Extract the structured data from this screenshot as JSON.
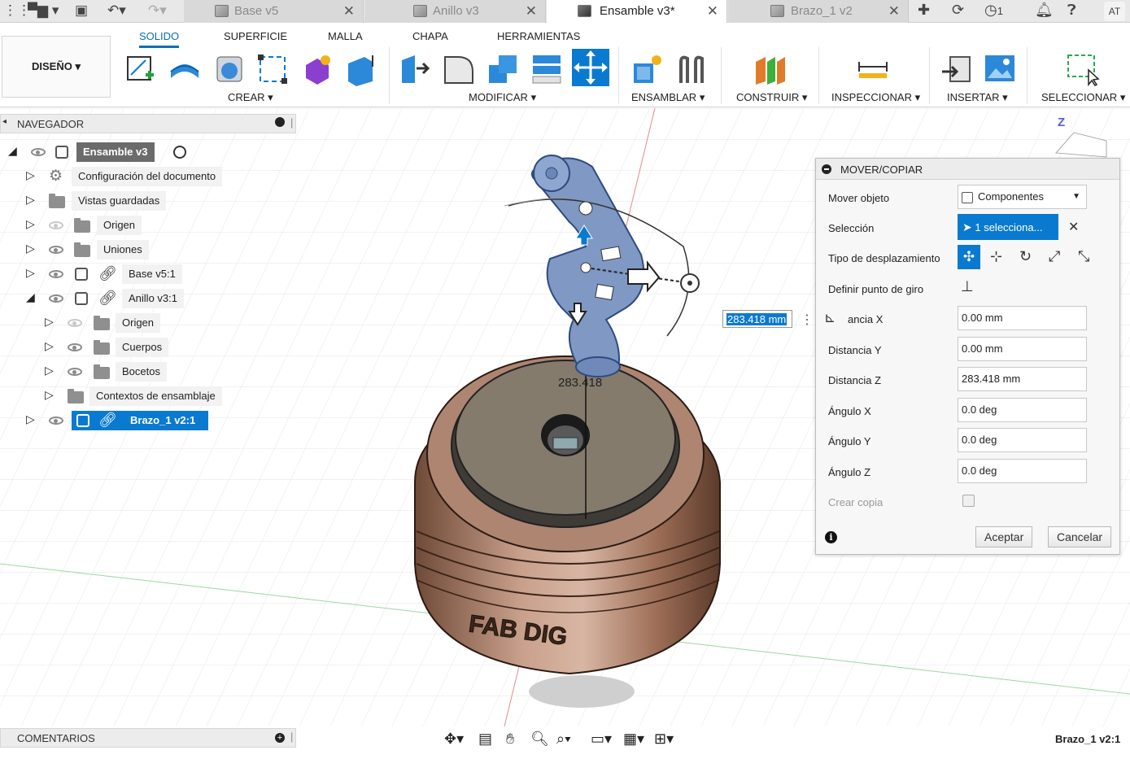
{
  "tabs": [
    {
      "label": "Base v5",
      "active": false
    },
    {
      "label": "Anillo v3",
      "active": false
    },
    {
      "label": "Ensamble v3*",
      "active": true
    },
    {
      "label": "Brazo_1 v2",
      "active": false
    }
  ],
  "titlebar": {
    "clock_count": "1",
    "user_initials": "AT"
  },
  "ribbon": {
    "workspace": "DISEÑO",
    "tabs": [
      "SOLIDO",
      "SUPERFICIE",
      "MALLA",
      "CHAPA",
      "HERRAMIENTAS"
    ],
    "groups": [
      "CREAR",
      "MODIFICAR",
      "ENSAMBLAR",
      "CONSTRUIR",
      "INSPECCIONAR",
      "INSERTAR",
      "SELECCIONAR"
    ]
  },
  "navigator": {
    "title": "NAVEGADOR",
    "root": "Ensamble v3",
    "items": [
      "Configuración del documento",
      "Vistas guardadas",
      "Origen",
      "Uniones",
      "Base v5:1",
      "Anillo v3:1",
      "Origen",
      "Cuerpos",
      "Bocetos",
      "Contextos de ensamblaje",
      "Brazo_1 v2:1"
    ]
  },
  "viewport": {
    "distance_input": "283.418 mm",
    "distance_label": "283.418",
    "engraving": "FAB DIG",
    "viewcube_axis": "Z"
  },
  "dialog": {
    "title": "MOVER/COPIAR",
    "move_object_label": "Mover objeto",
    "move_object_value": "Componentes",
    "selection_label": "Selección",
    "selection_value": "1 selecciona...",
    "move_type_label": "Tipo de desplazamiento",
    "pivot_label": "Definir punto de giro",
    "dist_x_label": "ancia X",
    "dist_x": "0.00 mm",
    "dist_y_label": "Distancia Y",
    "dist_y": "0.00 mm",
    "dist_z_label": "Distancia Z",
    "dist_z": "283.418 mm",
    "angle_x_label": "Ángulo X",
    "angle_x": "0.0 deg",
    "angle_y_label": "Ángulo Y",
    "angle_y": "0.0 deg",
    "angle_z_label": "Ángulo Z",
    "angle_z": "0.0 deg",
    "copy_label": "Crear copia",
    "ok": "Aceptar",
    "cancel": "Cancelar"
  },
  "bottom": {
    "comments": "COMENTARIOS",
    "status": "Brazo_1 v2:1"
  },
  "colors": {
    "accent": "#0a7ad0",
    "body_bronze": "#b98c76",
    "arm_blue": "#7f98c4"
  }
}
